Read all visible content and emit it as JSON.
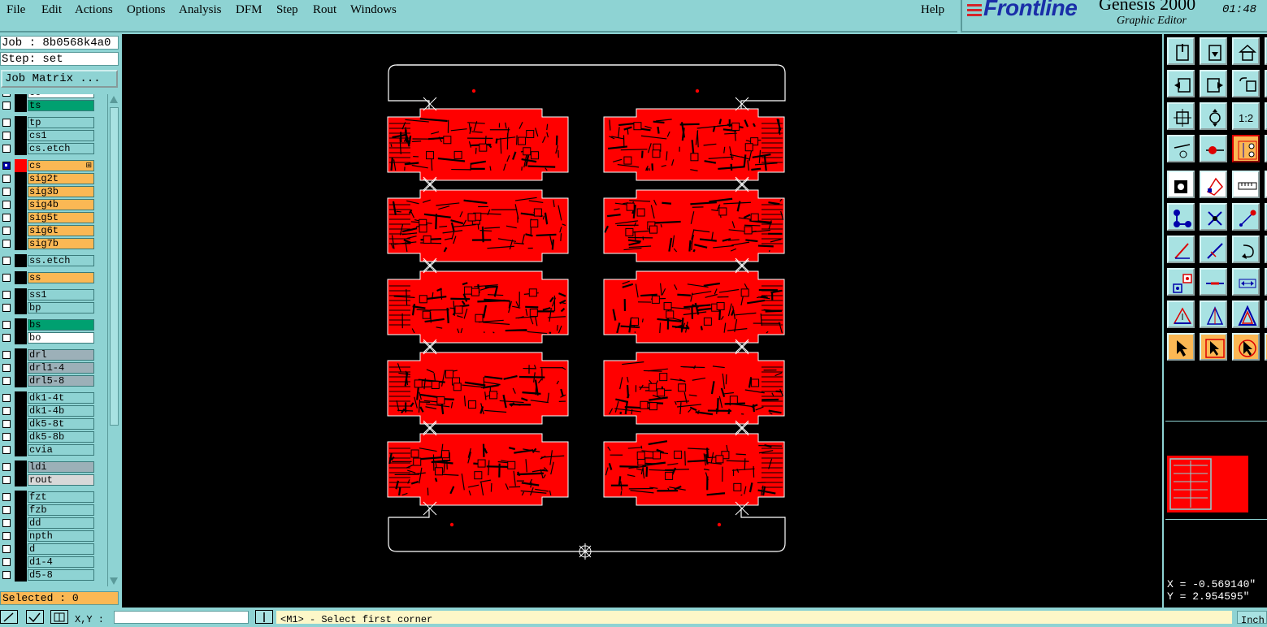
{
  "menu": [
    "File",
    "Edit",
    "Actions",
    "Options",
    "Analysis",
    "DFM",
    "Step",
    "Rout",
    "Windows"
  ],
  "help": "Help",
  "brand": {
    "logo": "Frontline",
    "title": "Genesis 2000",
    "subtitle": "Graphic Editor",
    "clock": "01:48"
  },
  "job": {
    "job_line": "Job : 8b0568k4a0",
    "step_line": "Step: set",
    "matrix_button": "Job Matrix ..."
  },
  "layers": [
    {
      "name": "co",
      "color": "#ffffff",
      "checked": false,
      "partial": true
    },
    {
      "name": "ts",
      "color": "#00a070"
    },
    {
      "name": "tp",
      "color": "#8ed3d3"
    },
    {
      "name": "cs1",
      "color": "#8ed3d3"
    },
    {
      "name": "cs.etch",
      "color": "#8ed3d3"
    },
    {
      "name": "cs",
      "color": "#fbb854",
      "checked": true,
      "work": true
    },
    {
      "name": "sig2t",
      "color": "#fbb854"
    },
    {
      "name": "sig3b",
      "color": "#fbb854"
    },
    {
      "name": "sig4b",
      "color": "#fbb854"
    },
    {
      "name": "sig5t",
      "color": "#fbb854"
    },
    {
      "name": "sig6t",
      "color": "#fbb854"
    },
    {
      "name": "sig7b",
      "color": "#fbb854"
    },
    {
      "name": "ss.etch",
      "color": "#8ed3d3"
    },
    {
      "name": "ss",
      "color": "#fbb854"
    },
    {
      "name": "ss1",
      "color": "#8ed3d3"
    },
    {
      "name": "bp",
      "color": "#8ed3d3"
    },
    {
      "name": "bs",
      "color": "#00a070"
    },
    {
      "name": "bo",
      "color": "#ffffff"
    },
    {
      "name": "drl",
      "color": "#9cb0b8"
    },
    {
      "name": "drl1-4",
      "color": "#9cb0b8"
    },
    {
      "name": "drl5-8",
      "color": "#9cb0b8"
    },
    {
      "name": "dk1-4t",
      "color": "#8ed3d3"
    },
    {
      "name": "dk1-4b",
      "color": "#8ed3d3"
    },
    {
      "name": "dk5-8t",
      "color": "#8ed3d3"
    },
    {
      "name": "dk5-8b",
      "color": "#8ed3d3"
    },
    {
      "name": "cvia",
      "color": "#8ed3d3"
    },
    {
      "name": "ldi",
      "color": "#9cb0b8"
    },
    {
      "name": "rout",
      "color": "#d8d8d8"
    },
    {
      "name": "fzt",
      "color": "#8ed3d3"
    },
    {
      "name": "fzb",
      "color": "#8ed3d3"
    },
    {
      "name": "dd",
      "color": "#8ed3d3"
    },
    {
      "name": "npth",
      "color": "#8ed3d3"
    },
    {
      "name": "d",
      "color": "#8ed3d3"
    },
    {
      "name": "d1-4",
      "color": "#8ed3d3"
    },
    {
      "name": "d5-8",
      "color": "#8ed3d3"
    }
  ],
  "selected": "Selected : 0",
  "coords": {
    "x": "X = -0.569140\"",
    "y": "Y =  2.954595\""
  },
  "status": {
    "xy_label": "X,Y :",
    "xy_value": "",
    "message": "<M1> - Select first corner",
    "units": "Inch"
  },
  "board": {
    "colors": {
      "copper": "#ff0000",
      "outline": "#ffffff",
      "background": "#000000"
    },
    "columns": 2,
    "rows": 5
  },
  "toolbar_icons": [
    "import-icon",
    "export-icon",
    "home-icon",
    "pan-left-icon",
    "pan-right-icon",
    "undo-view-icon",
    "zoom-fit-icon",
    "zoom-center-icon",
    "scale-1-2-icon",
    "measure-icon",
    "probe-icon",
    "net-icon",
    "select-pad-icon",
    "feature-icon",
    "ruler-icon",
    "connect-icon",
    "delete-icon",
    "add-point-icon",
    "line-left-icon",
    "line-right-icon",
    "rotate-icon",
    "pad-icon",
    "segment-icon",
    "stretch-icon",
    "move-up-icon",
    "move-icon",
    "copy-icon",
    "pointer-icon",
    "pointer-box-icon",
    "pointer-circle-icon"
  ]
}
